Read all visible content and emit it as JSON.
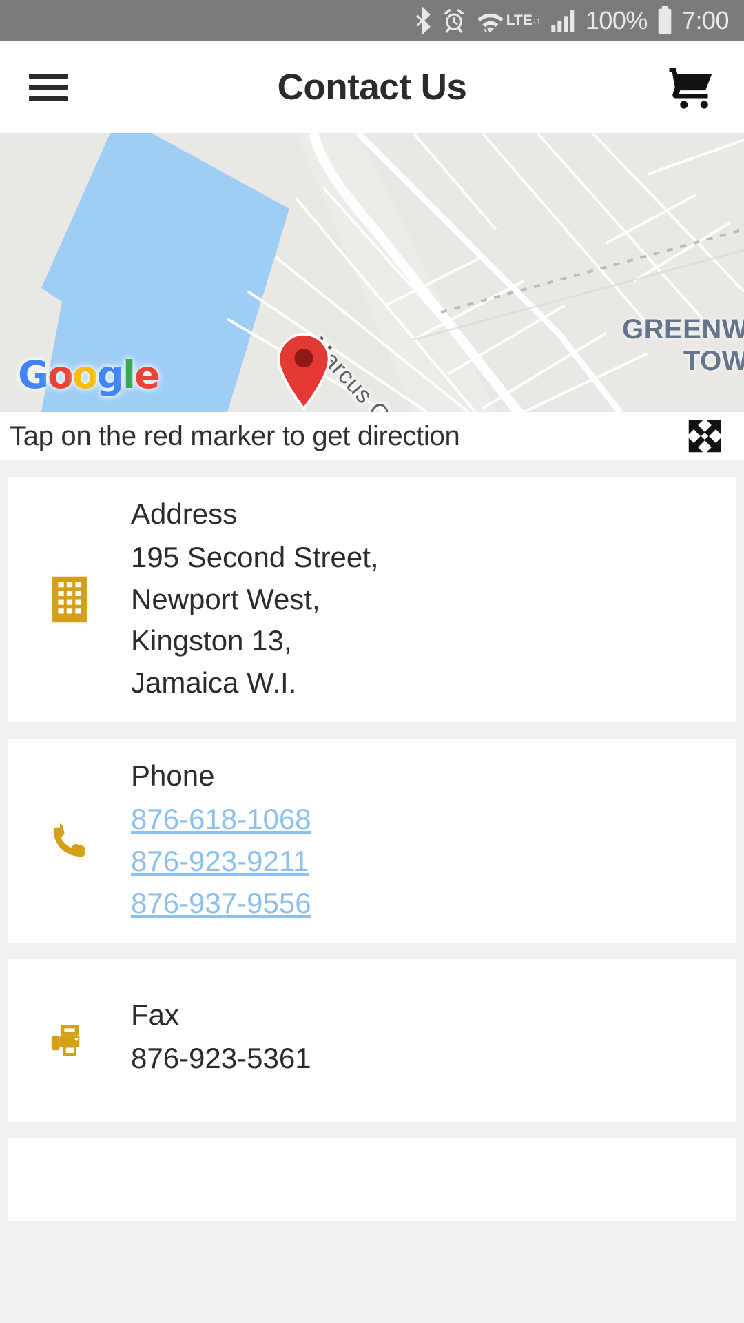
{
  "status_bar": {
    "icons": [
      "bluetooth-icon",
      "alarm-icon",
      "wifi-icon",
      "lte-icon",
      "signal-icon"
    ],
    "lte_label": "LTE",
    "battery_percent": "100%",
    "time": "7:00"
  },
  "app_bar": {
    "menu_icon": "hamburger-menu-icon",
    "title": "Contact Us",
    "cart_icon": "shopping-cart-icon"
  },
  "map": {
    "road_label": "Marcus Garvey Dr",
    "place_label_line1": "GREENW",
    "place_label_line2": "TOW",
    "attribution": {
      "g1": "G",
      "o1": "o",
      "o2": "o",
      "g2": "g",
      "l": "l",
      "e": "e"
    },
    "marker_icon": "map-marker-icon",
    "water_color": "#9ecdf6",
    "land_color": "#e9e8e4",
    "marker_color": "#e53935"
  },
  "tap_bar": {
    "text": "Tap on the red marker to get direction",
    "expand_icon": "fullscreen-expand-icon"
  },
  "cards": [
    {
      "icon": "building-icon",
      "label": "Address",
      "lines": [
        "195 Second Street,",
        "Newport West,",
        "Kingston 13,",
        "Jamaica W.I."
      ]
    },
    {
      "icon": "phone-icon",
      "label": "Phone",
      "links": [
        "876-618-1068",
        "876-923-9211",
        "876-937-9556"
      ]
    },
    {
      "icon": "fax-icon",
      "label": "Fax",
      "value": "876-923-5361"
    }
  ],
  "theme": {
    "accent_gold": "#d4a017",
    "link_blue": "#8cc0ef",
    "text_dark": "#2b2b2b",
    "page_bg": "#f1f1f1",
    "status_bar_bg": "#7b7b7b"
  }
}
